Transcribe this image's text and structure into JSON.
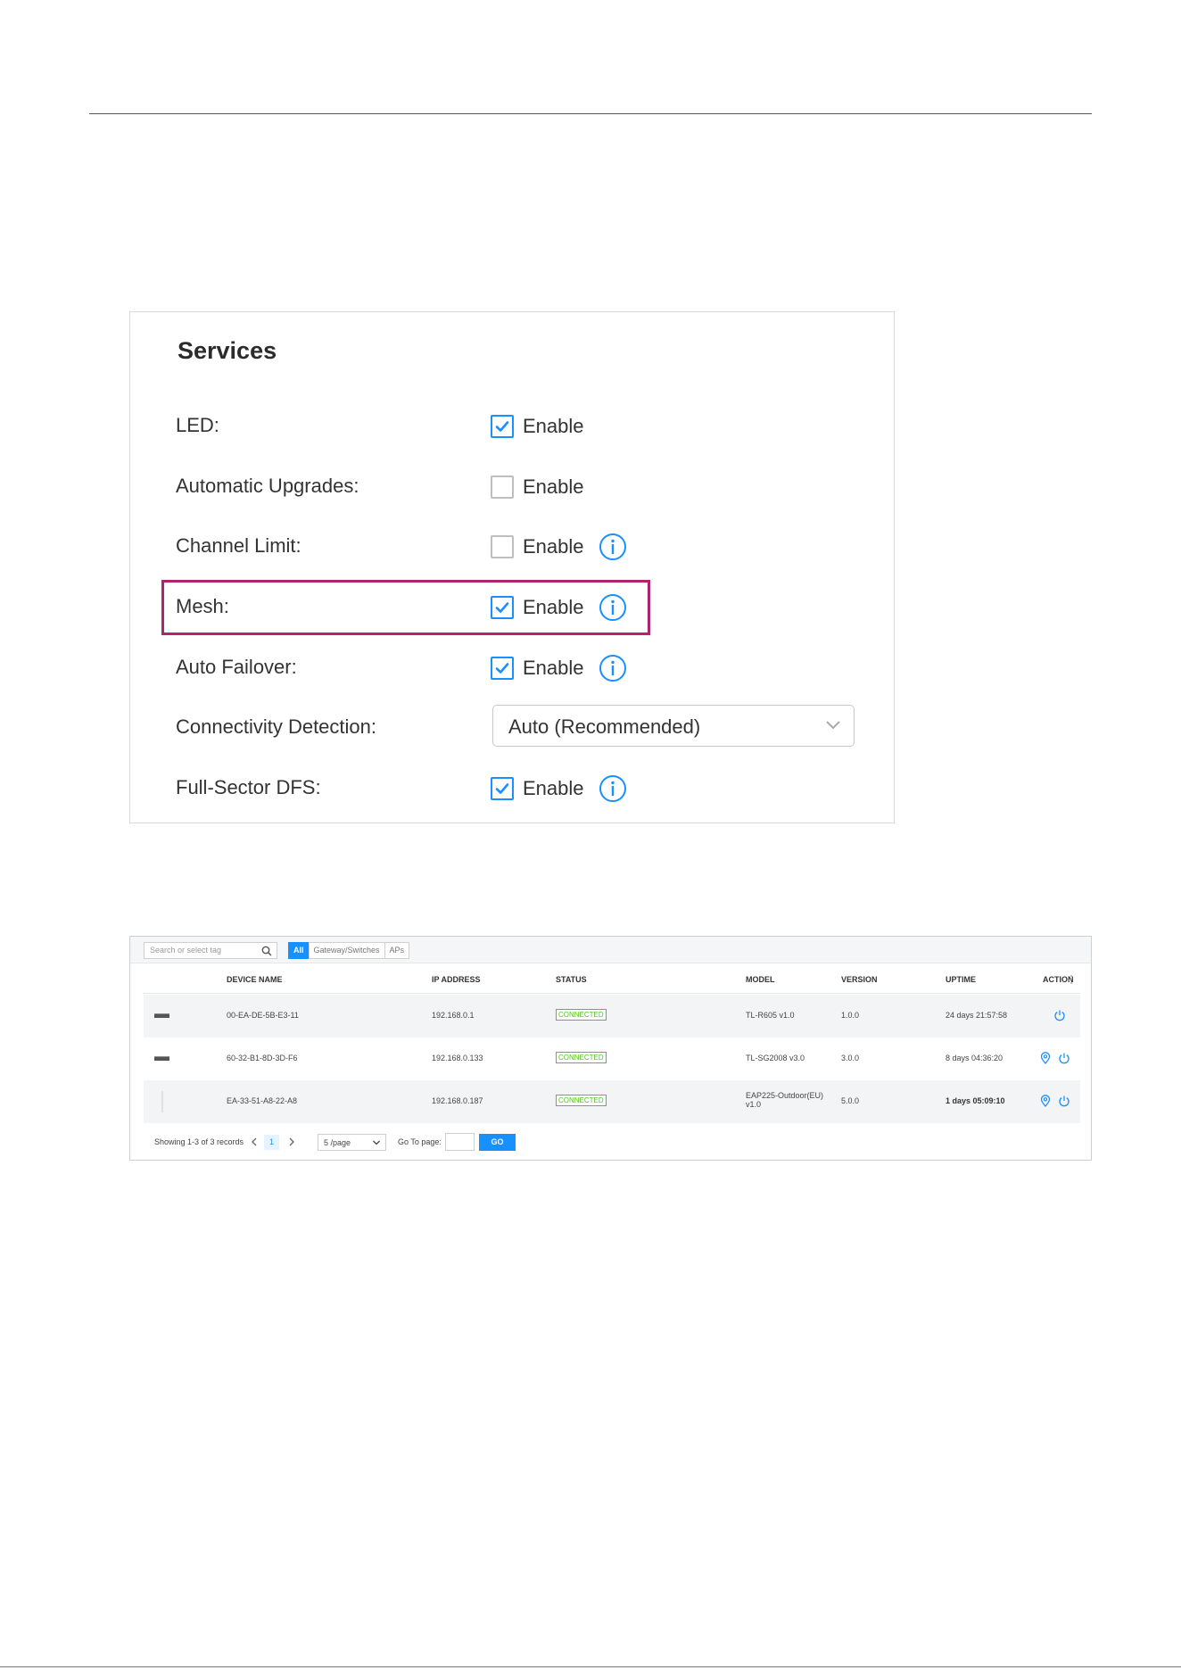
{
  "services": {
    "title": "Services",
    "rows": [
      {
        "label": "LED:",
        "checked": true,
        "text": "Enable",
        "info": false
      },
      {
        "label": "Automatic Upgrades:",
        "checked": false,
        "text": "Enable",
        "info": false
      },
      {
        "label": "Channel Limit:",
        "checked": false,
        "text": "Enable",
        "info": true
      },
      {
        "label": "Mesh:",
        "checked": true,
        "text": "Enable",
        "info": true
      },
      {
        "label": "Auto Failover:",
        "checked": true,
        "text": "Enable",
        "info": true
      },
      {
        "label": "Connectivity Detection:",
        "select_value": "Auto (Recommended)"
      },
      {
        "label": "Full-Sector DFS:",
        "checked": true,
        "text": "Enable",
        "info": true
      }
    ],
    "highlight_color": "#b0236f",
    "accent_color": "#1890ff"
  },
  "devices": {
    "search_placeholder": "Search or select tag",
    "tabs": [
      "All",
      "Gateway/Switches",
      "APs"
    ],
    "active_tab": "All",
    "columns": [
      "DEVICE NAME",
      "IP ADDRESS",
      "STATUS",
      "MODEL",
      "VERSION",
      "UPTIME",
      "ACTION"
    ],
    "rows": [
      {
        "icon": "gateway-icon",
        "name": "00-EA-DE-5B-E3-11",
        "ip": "192.168.0.1",
        "status": "CONNECTED",
        "model": "TL-R605 v1.0",
        "version": "1.0.0",
        "uptime": "24 days 21:57:58",
        "actions": [
          "power-icon"
        ]
      },
      {
        "icon": "switch-icon",
        "name": "60-32-B1-8D-3D-F6",
        "ip": "192.168.0.133",
        "status": "CONNECTED",
        "model": "TL-SG2008 v3.0",
        "version": "3.0.0",
        "uptime": "8 days 04:36:20",
        "actions": [
          "locate-icon",
          "power-icon"
        ]
      },
      {
        "icon": "ap-icon",
        "name": "EA-33-51-A8-22-A8",
        "ip": "192.168.0.187",
        "status": "CONNECTED",
        "model_line1": "EAP225-Outdoor(EU)",
        "model_line2": "v1.0",
        "version": "5.0.0",
        "uptime": "1 days 05:09:10",
        "actions": [
          "locate-icon",
          "power-icon"
        ]
      }
    ],
    "pager": {
      "summary": "Showing 1-3 of 3 records",
      "current_page": "1",
      "page_size": "5 /page",
      "goto_label": "Go To page:",
      "go_label": "GO"
    },
    "status_color": "#52c41a"
  }
}
